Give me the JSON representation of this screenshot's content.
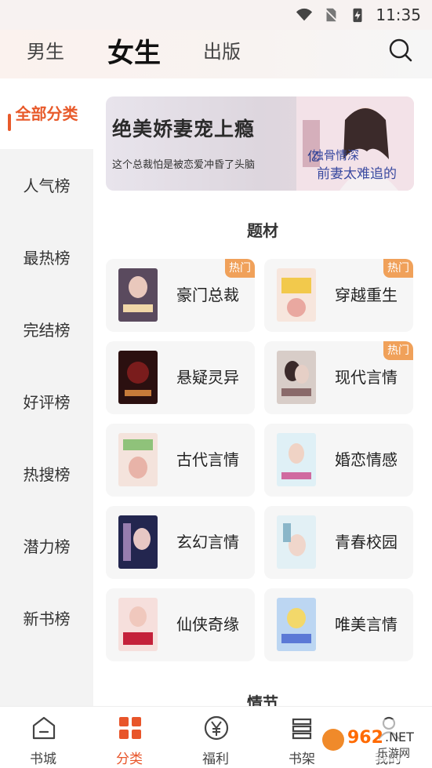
{
  "status_bar": {
    "time": "11:35"
  },
  "top_tabs": {
    "male": "男生",
    "female": "女生",
    "publish": "出版"
  },
  "sidebar": {
    "items": [
      {
        "label": "全部分类"
      },
      {
        "label": "人气榜"
      },
      {
        "label": "最热榜"
      },
      {
        "label": "完结榜"
      },
      {
        "label": "好评榜"
      },
      {
        "label": "热搜榜"
      },
      {
        "label": "潜力榜"
      },
      {
        "label": "新书榜"
      }
    ]
  },
  "banner": {
    "title": "绝美娇妻宠上瘾",
    "subtitle": "这个总裁怕是被恋爱冲昏了头脑",
    "art_text": "蚀骨情深前妻太难追的"
  },
  "sections": {
    "theme_title": "题材",
    "plot_title": "情节"
  },
  "hot_badge": "热门",
  "genres": [
    {
      "name": "豪门总裁",
      "hot": true,
      "cover_color": "#5a4a5e"
    },
    {
      "name": "穿越重生",
      "hot": true,
      "cover_color": "#f2d6c8"
    },
    {
      "name": "悬疑灵异",
      "hot": false,
      "cover_color": "#3a1616"
    },
    {
      "name": "现代言情",
      "hot": true,
      "cover_color": "#c9b7b2"
    },
    {
      "name": "古代言情",
      "hot": false,
      "cover_color": "#f1d2cd"
    },
    {
      "name": "婚恋情感",
      "hot": false,
      "cover_color": "#d9eef5"
    },
    {
      "name": "玄幻言情",
      "hot": false,
      "cover_color": "#2c2f5e"
    },
    {
      "name": "青春校园",
      "hot": false,
      "cover_color": "#d5e9f2"
    },
    {
      "name": "仙侠奇缘",
      "hot": false,
      "cover_color": "#f1c2ba"
    },
    {
      "name": "唯美言情",
      "hot": false,
      "cover_color": "#b8d3f0"
    }
  ],
  "bottom_nav": [
    {
      "label": "书城"
    },
    {
      "label": "分类"
    },
    {
      "label": "福利"
    },
    {
      "label": "书架"
    },
    {
      "label": "我的"
    }
  ],
  "watermark": "962.NET 乐游网",
  "colors": {
    "accent": "#e8552a",
    "hot": "#f0a15a"
  }
}
